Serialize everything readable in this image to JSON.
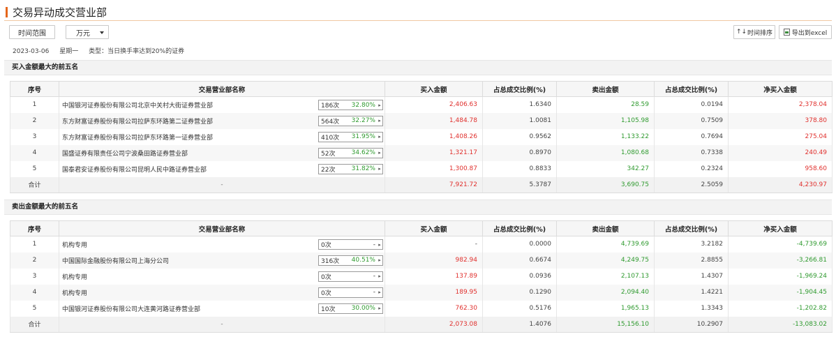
{
  "page": {
    "title": "交易异动成交营业部"
  },
  "toolbar": {
    "range_label": "时间范围",
    "unit_label": "万元",
    "sort_icon": "↑↓",
    "sort_label": "时间排序",
    "export_label": "导出到excel"
  },
  "meta": {
    "date": "2023-03-06",
    "weekday": "星期一",
    "type": "类型：当日换手率达到20%的证券"
  },
  "columns": [
    "序号",
    "交易营业部名称",
    "买入金额",
    "占总成交比例(%)",
    "卖出金额",
    "占总成交比例(%)",
    "净买入金额"
  ],
  "buy_section": {
    "title": "买入金额最大的前五名",
    "rows": [
      {
        "idx": "1",
        "name": "中国银河证券股份有限公司北京中关村大街证券营业部",
        "count": "186次",
        "pct": "32.80%",
        "buy": "2,406.63",
        "buy_ratio": "1.6340",
        "sell": "28.59",
        "sell_ratio": "0.0194",
        "net": "2,378.04"
      },
      {
        "idx": "2",
        "name": "东方财富证券股份有限公司拉萨东环路第二证券营业部",
        "count": "564次",
        "pct": "32.27%",
        "buy": "1,484.78",
        "buy_ratio": "1.0081",
        "sell": "1,105.98",
        "sell_ratio": "0.7509",
        "net": "378.80"
      },
      {
        "idx": "3",
        "name": "东方财富证券股份有限公司拉萨东环路第一证券营业部",
        "count": "410次",
        "pct": "31.95%",
        "buy": "1,408.26",
        "buy_ratio": "0.9562",
        "sell": "1,133.22",
        "sell_ratio": "0.7694",
        "net": "275.04"
      },
      {
        "idx": "4",
        "name": "国盛证券有限责任公司宁波桑田路证券营业部",
        "count": "52次",
        "pct": "34.62%",
        "buy": "1,321.17",
        "buy_ratio": "0.8970",
        "sell": "1,080.68",
        "sell_ratio": "0.7338",
        "net": "240.49"
      },
      {
        "idx": "5",
        "name": "国泰君安证券股份有限公司昆明人民中路证券营业部",
        "count": "22次",
        "pct": "31.82%",
        "buy": "1,300.87",
        "buy_ratio": "0.8833",
        "sell": "342.27",
        "sell_ratio": "0.2324",
        "net": "958.60"
      }
    ],
    "total": {
      "label": "合计",
      "name": "-",
      "buy": "7,921.72",
      "buy_ratio": "5.3787",
      "sell": "3,690.75",
      "sell_ratio": "2.5059",
      "net": "4,230.97"
    }
  },
  "sell_section": {
    "title": "卖出金额最大的前五名",
    "rows": [
      {
        "idx": "1",
        "name": "机构专用",
        "count": "0次",
        "pct": "-",
        "buy": "-",
        "buy_ratio": "0.0000",
        "sell": "4,739.69",
        "sell_ratio": "3.2182",
        "net": "-4,739.69"
      },
      {
        "idx": "2",
        "name": "中国国际金融股份有限公司上海分公司",
        "count": "316次",
        "pct": "40.51%",
        "buy": "982.94",
        "buy_ratio": "0.6674",
        "sell": "4,249.75",
        "sell_ratio": "2.8855",
        "net": "-3,266.81"
      },
      {
        "idx": "3",
        "name": "机构专用",
        "count": "0次",
        "pct": "-",
        "buy": "137.89",
        "buy_ratio": "0.0936",
        "sell": "2,107.13",
        "sell_ratio": "1.4307",
        "net": "-1,969.24"
      },
      {
        "idx": "4",
        "name": "机构专用",
        "count": "0次",
        "pct": "-",
        "buy": "189.95",
        "buy_ratio": "0.1290",
        "sell": "2,094.40",
        "sell_ratio": "1.4221",
        "net": "-1,904.45"
      },
      {
        "idx": "5",
        "name": "中国银河证券股份有限公司大连黄河路证券营业部",
        "count": "10次",
        "pct": "30.00%",
        "buy": "762.30",
        "buy_ratio": "0.5176",
        "sell": "1,965.13",
        "sell_ratio": "1.3343",
        "net": "-1,202.82"
      }
    ],
    "total": {
      "label": "合计",
      "name": "-",
      "buy": "2,073.08",
      "buy_ratio": "1.4076",
      "sell": "15,156.10",
      "sell_ratio": "10.2907",
      "net": "-13,083.02"
    }
  },
  "colors": {
    "accent": "#e4661b",
    "positive": "#e0302d",
    "negative": "#2f9a2f"
  }
}
